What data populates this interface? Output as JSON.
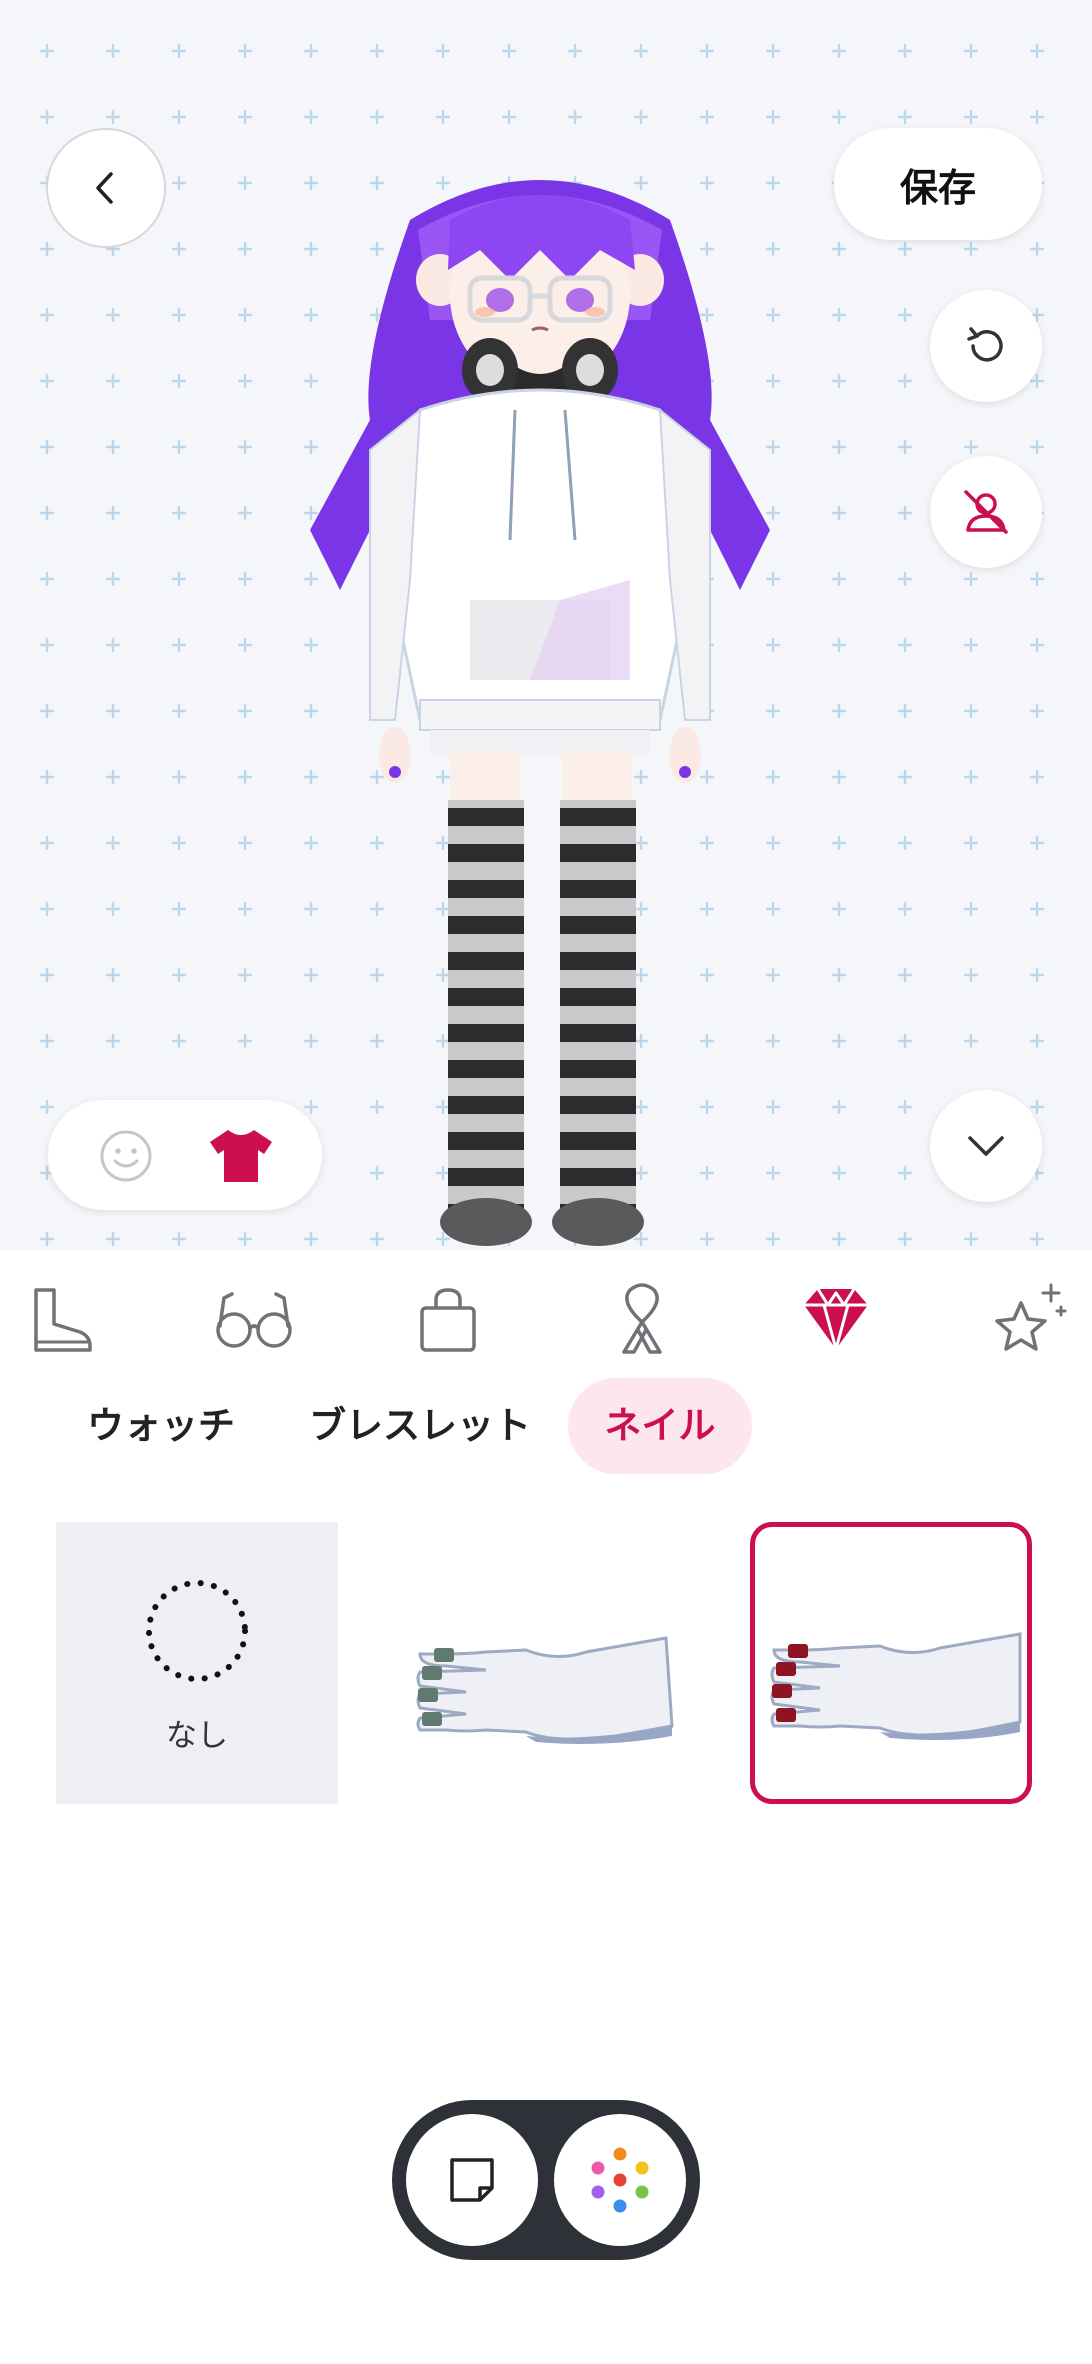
{
  "header": {
    "save_label": "保存"
  },
  "icons": {
    "back": "chevron-left-icon",
    "reset": "rotate-ccw-icon",
    "hide": "person-off-icon",
    "collapse": "chevron-down-icon",
    "face": "smile-icon",
    "outfit": "tshirt-icon",
    "sticky_note": "sticky-note-icon",
    "palette": "palette-dots-icon"
  },
  "categories": [
    {
      "name": "boots-icon",
      "active": false
    },
    {
      "name": "glasses-icon",
      "active": false
    },
    {
      "name": "bag-icon",
      "active": false
    },
    {
      "name": "ribbon-icon",
      "active": false
    },
    {
      "name": "gem-icon",
      "active": true
    },
    {
      "name": "sparkle-star-icon",
      "active": false
    }
  ],
  "subtabs": [
    "ウォッチ",
    "ブレスレット",
    "ネイル"
  ],
  "subtabs_active": 2,
  "items": {
    "none_label": "なし",
    "hand1_nail_color": "#5f7a6e",
    "hand2_nail_color": "#8e1423"
  },
  "colors": {
    "accent": "#cc0f4f",
    "accent_bg": "#fde6ec",
    "hair": "#8a3df0",
    "pill_bg": "#2e3238"
  }
}
